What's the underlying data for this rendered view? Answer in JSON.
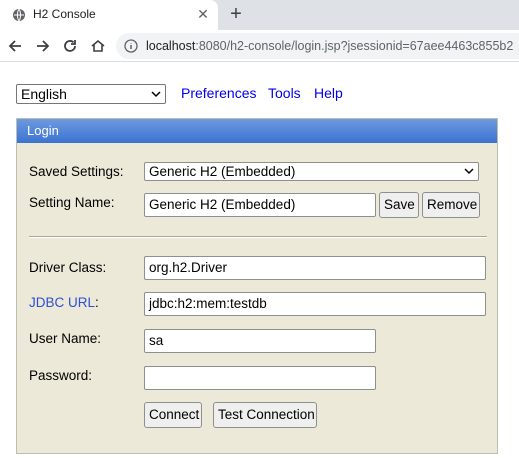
{
  "browser": {
    "tab_title": "H2 Console",
    "url_host": "localhost",
    "url_rest": ":8080/h2-console/login.jsp?jsessionid=67aee4463c855b2"
  },
  "topbar": {
    "language": "English",
    "preferences": "Preferences",
    "tools": "Tools",
    "help": "Help"
  },
  "login": {
    "header": "Login",
    "saved_settings_label": "Saved Settings:",
    "saved_settings_value": "Generic H2 (Embedded)",
    "setting_name_label": "Setting Name:",
    "setting_name_value": "Generic H2 (Embedded)",
    "save": "Save",
    "remove": "Remove",
    "driver_class_label": "Driver Class:",
    "driver_class_value": "org.h2.Driver",
    "jdbc_url_link": "JDBC URL",
    "jdbc_url_colon": ":",
    "jdbc_url_value": "jdbc:h2:mem:testdb",
    "user_name_label": "User Name:",
    "user_name_value": "sa",
    "password_label": "Password:",
    "password_value": "",
    "connect": "Connect",
    "test_connection": "Test Connection"
  }
}
